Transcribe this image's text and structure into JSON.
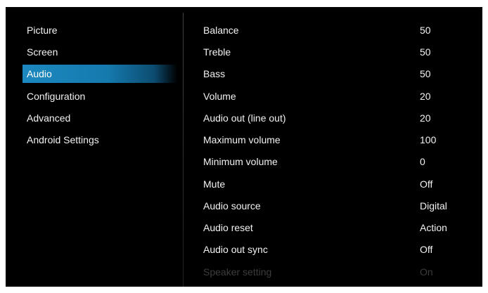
{
  "sidebar": {
    "items": [
      {
        "label": "Picture"
      },
      {
        "label": "Screen"
      },
      {
        "label": "Audio"
      },
      {
        "label": "Configuration"
      },
      {
        "label": "Advanced"
      },
      {
        "label": "Android Settings"
      }
    ],
    "selected": "Audio"
  },
  "settings": {
    "rows": [
      {
        "label": "Balance",
        "value": "50"
      },
      {
        "label": "Treble",
        "value": "50"
      },
      {
        "label": "Bass",
        "value": "50"
      },
      {
        "label": "Volume",
        "value": "20"
      },
      {
        "label": "Audio out (line out)",
        "value": "20"
      },
      {
        "label": "Maximum volume",
        "value": "100"
      },
      {
        "label": "Minimum volume",
        "value": "0"
      },
      {
        "label": "Mute",
        "value": "Off"
      },
      {
        "label": "Audio source",
        "value": "Digital"
      },
      {
        "label": "Audio reset",
        "value": "Action"
      },
      {
        "label": "Audio out sync",
        "value": "Off"
      },
      {
        "label": "Speaker setting",
        "value": "On"
      }
    ]
  },
  "colors": {
    "background": "#000000",
    "selection": "#1a86bd",
    "text": "#f2f2f2"
  }
}
